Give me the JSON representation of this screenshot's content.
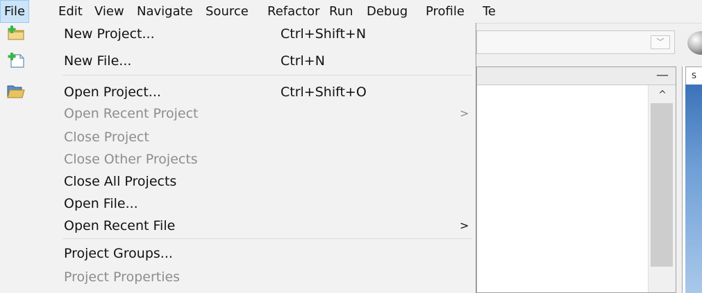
{
  "menubar": {
    "items": [
      {
        "label": "File"
      },
      {
        "label": "Edit"
      },
      {
        "label": "View"
      },
      {
        "label": "Navigate"
      },
      {
        "label": "Source"
      },
      {
        "label": "Refactor"
      },
      {
        "label": "Run"
      },
      {
        "label": "Debug"
      },
      {
        "label": "Profile"
      },
      {
        "label": "Te"
      }
    ]
  },
  "file_menu": {
    "items": [
      {
        "label": "New Project...",
        "shortcut": "Ctrl+Shift+N",
        "icon": "new-project-icon",
        "enabled": true
      },
      {
        "label": "New File...",
        "shortcut": "Ctrl+N",
        "icon": "new-file-icon",
        "enabled": true
      },
      {
        "label": "Open Project...",
        "shortcut": "Ctrl+Shift+O",
        "icon": "open-project-icon",
        "enabled": true
      },
      {
        "label": "Open Recent Project",
        "submenu_arrow": ">",
        "enabled": false
      },
      {
        "label": "Close Project",
        "enabled": false
      },
      {
        "label": "Close Other Projects",
        "enabled": false
      },
      {
        "label": "Close All Projects",
        "enabled": true
      },
      {
        "label": "Open File...",
        "enabled": true
      },
      {
        "label": "Open Recent File",
        "submenu_arrow": ">",
        "enabled": true
      },
      {
        "label": "Project Groups...",
        "enabled": true
      },
      {
        "label": "Project Properties",
        "enabled": false
      }
    ]
  },
  "background": {
    "combo_arrow": "﹀",
    "panel_minimize": "—",
    "scroll_up": "^",
    "editor_tab": "S"
  },
  "colors": {
    "menu_bg": "#f2f2f2",
    "open_menu_highlight": "#cce4f7",
    "disabled_text": "#8d8d8d"
  }
}
